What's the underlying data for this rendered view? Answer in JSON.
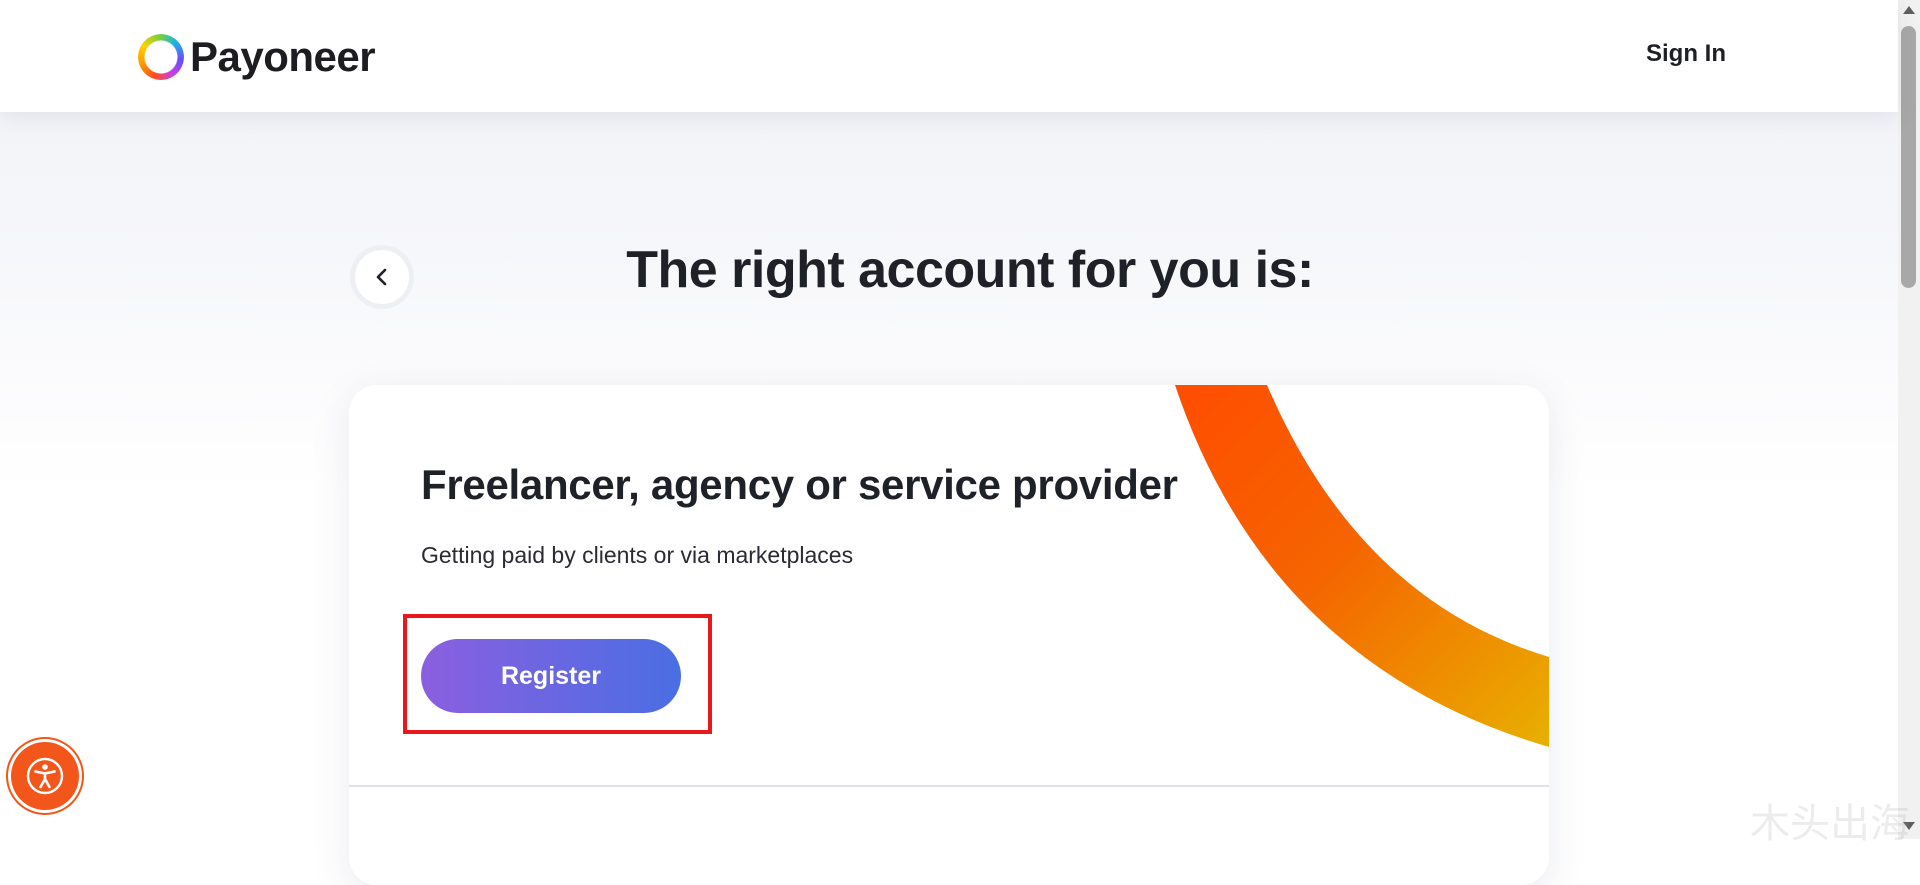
{
  "header": {
    "logo_text": "Payoneer",
    "signin_label": "Sign In"
  },
  "page": {
    "title": "The right account for you is:"
  },
  "card": {
    "title": "Freelancer, agency or service provider",
    "subtitle": "Getting paid by clients or via marketplaces",
    "register_label": "Register"
  },
  "icons": {
    "back": "chevron-left-icon",
    "accessibility": "accessibility-icon",
    "logo": "payoneer-ring-logo"
  },
  "watermark": "木头出海",
  "colors": {
    "brand_text": "#1c1c21",
    "button_gradient_start": "#8b5fdf",
    "button_gradient_end": "#4a6ee3",
    "arc_start": "#ff4d00",
    "arc_end": "#e8b000",
    "highlight": "#e8191c",
    "accessibility": "#f2561a"
  }
}
